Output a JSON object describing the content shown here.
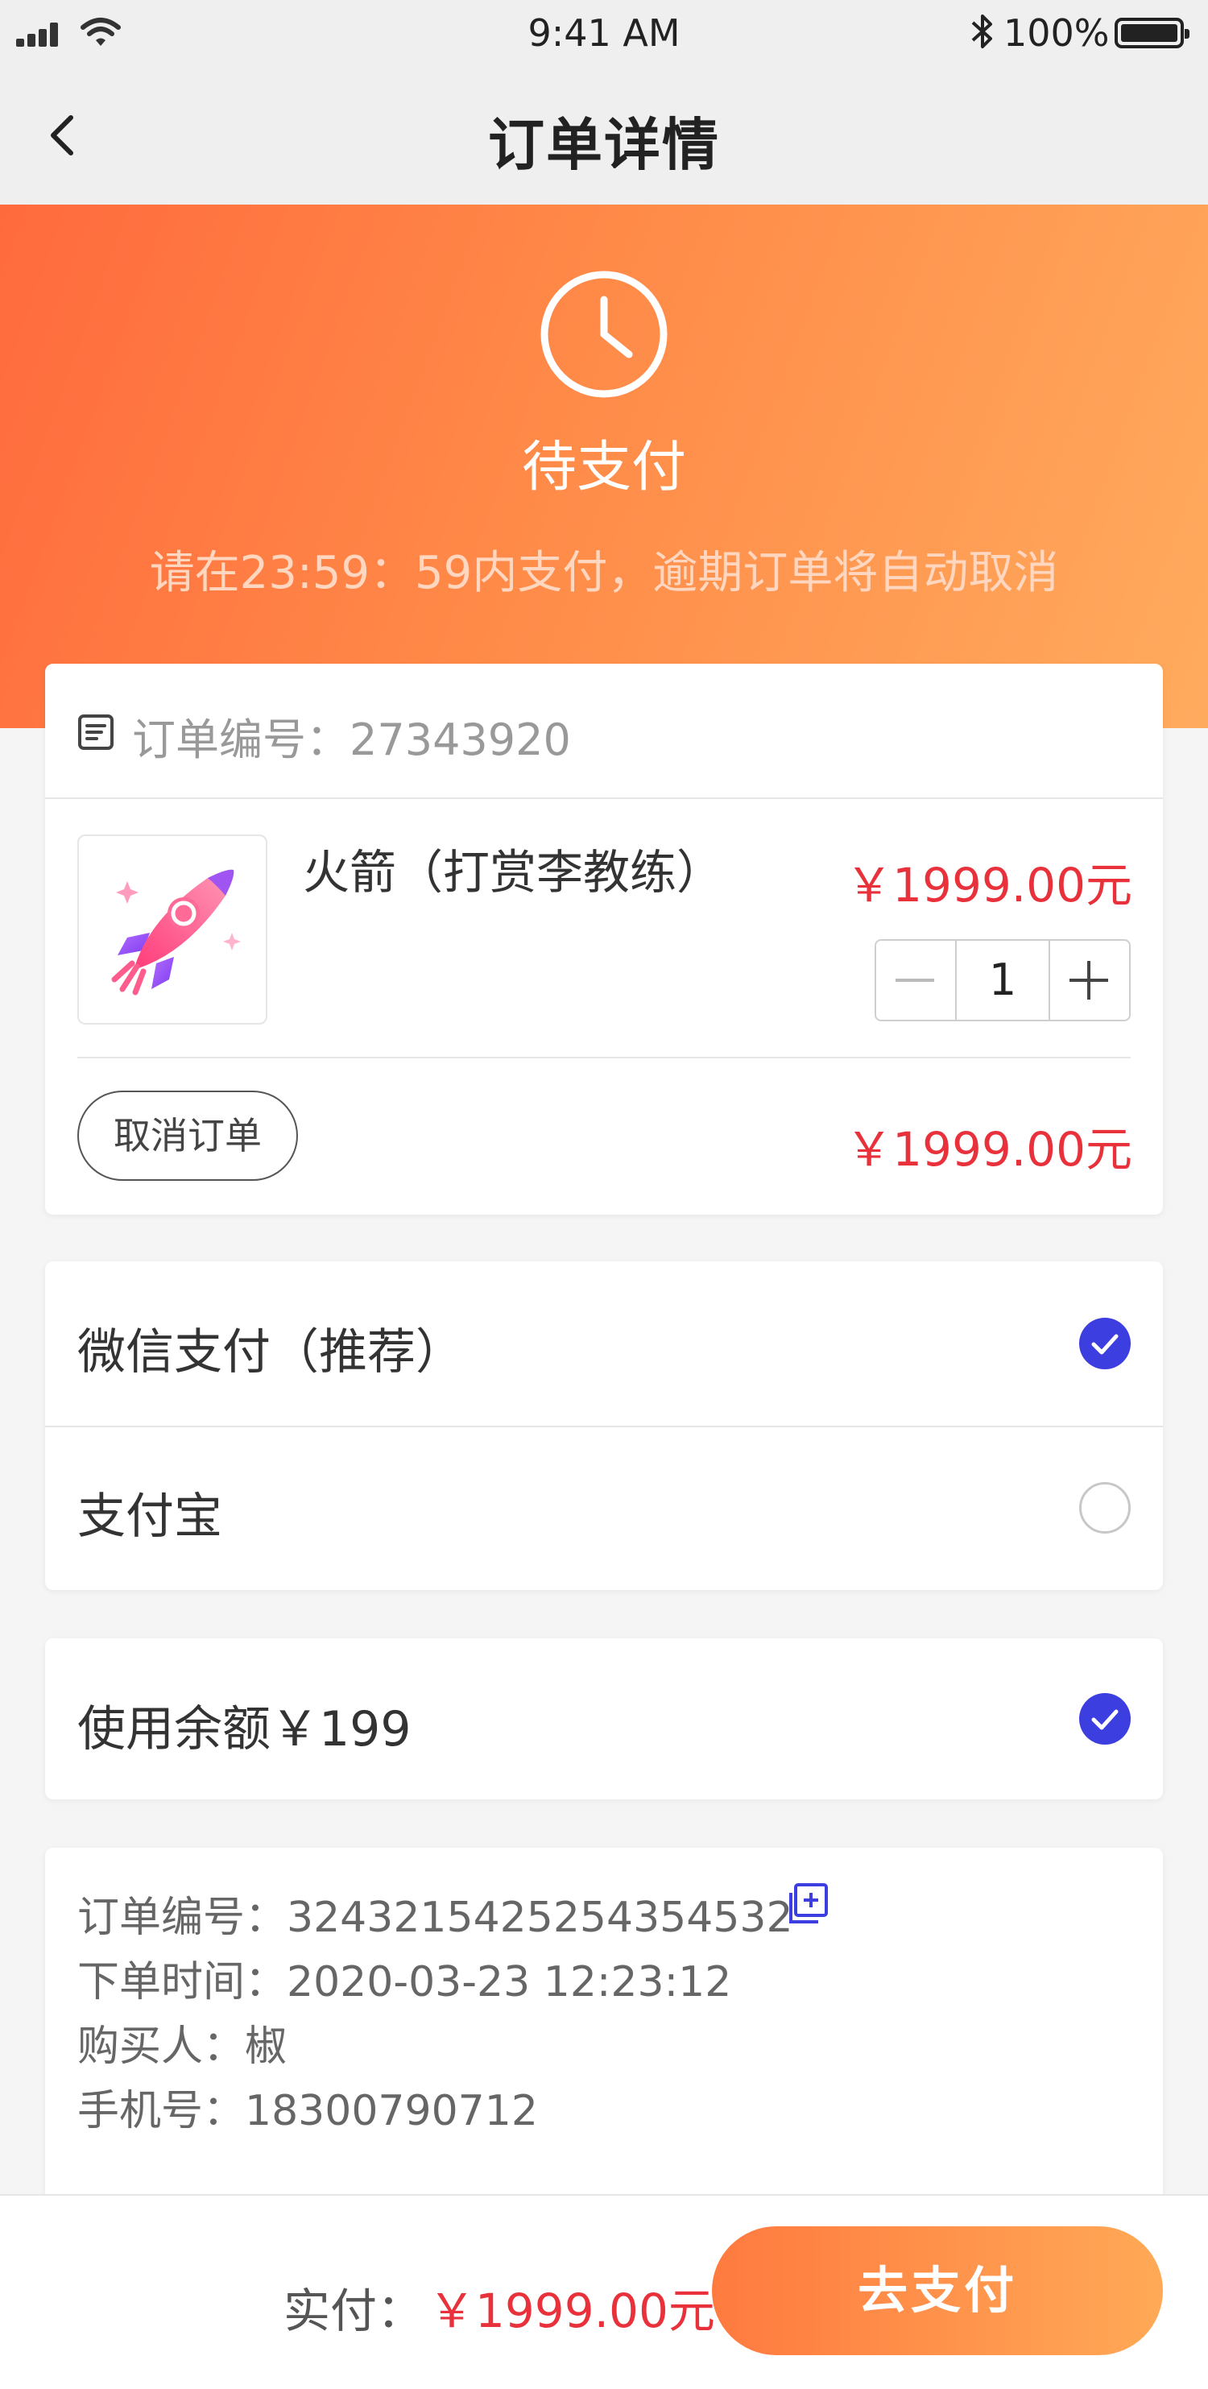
{
  "status_bar": {
    "time": "9:41 AM",
    "battery": "100%"
  },
  "nav": {
    "title": "订单详情"
  },
  "header": {
    "status_title": "待支付",
    "countdown_text": "请在23:59：59内支付，逾期订单将自动取消",
    "gradient_start": "#ff6a3d",
    "gradient_end": "#ffab5e"
  },
  "order": {
    "number_label": "订单编号：27343920",
    "product": {
      "name": "火箭（打赏李教练）",
      "price": "￥1999.00元",
      "quantity": "1",
      "image": "rocket-illustration"
    },
    "cancel_label": "取消订单",
    "total": "￥1999.00元"
  },
  "payment": {
    "methods": [
      {
        "label": "微信支付（推荐）",
        "selected": true
      },
      {
        "label": "支付宝",
        "selected": false
      }
    ],
    "accent": "#3d3ee0"
  },
  "balance": {
    "label": "使用余额￥199",
    "selected": true
  },
  "info": {
    "order_no": "订单编号：3243215425254354532",
    "order_time": "下单时间：2020-03-23 12:23:12",
    "buyer": "购买人：椒",
    "phone": "手机号：18300790712"
  },
  "bottom": {
    "paid_label": "实付：",
    "paid_amount": "￥1999.00元",
    "pay_button": "去支付"
  },
  "colors": {
    "price_red": "#e8313b",
    "button_orange": "#ff7a3f"
  }
}
